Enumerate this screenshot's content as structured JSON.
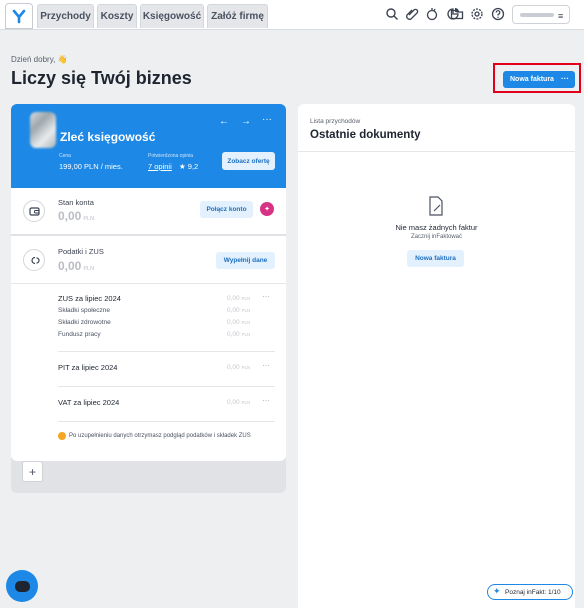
{
  "colors": {
    "accent": "#1d88e5",
    "highlight": "#e3001b",
    "bg": "#eeeff1"
  },
  "topbar": {
    "tabs": [
      {
        "label": "Przychody"
      },
      {
        "label": "Koszty"
      },
      {
        "label": "Księgowość"
      },
      {
        "label": "Załóż firmę"
      }
    ],
    "icons": [
      "search-icon",
      "attachment-icon",
      "settlements-icon",
      "chart-icon",
      "folder-icon",
      "settings-icon",
      "help-icon"
    ],
    "user_menu_icon": "≡"
  },
  "header": {
    "greeting": "Dzień dobry, 👋",
    "title": "Liczy się Twój biznes",
    "new_invoice": "Nowa faktura",
    "more": "···"
  },
  "promo": {
    "title": "Zleć księgowość",
    "price_label": "Cena",
    "price_value": "199,00 PLN / mies.",
    "reviews_label": "Potwierdzona opinia",
    "reviews_link": "7 opinii",
    "rating": "★ 9,2",
    "offer_button": "Zobacz ofertę",
    "prev": "←",
    "next": "→",
    "more": "···"
  },
  "account": {
    "label": "Stan konta",
    "amount": "0,00",
    "currency": "PLN",
    "connect_button": "Połącz konto"
  },
  "taxes": {
    "label": "Podatki i ZUS",
    "amount": "0,00",
    "currency": "PLN",
    "fill_button": "Wypełnij dane",
    "zus": {
      "title": "ZUS za lipiec 2024",
      "amount": "0,00",
      "currency": "PLN",
      "rows": [
        {
          "label": "Składki społeczne",
          "amount": "0,00",
          "currency": "PLN"
        },
        {
          "label": "Składki zdrowotne",
          "amount": "0,00",
          "currency": "PLN"
        },
        {
          "label": "Fundusz pracy",
          "amount": "0,00",
          "currency": "PLN"
        }
      ]
    },
    "pit": {
      "title": "PIT za lipiec 2024",
      "amount": "0,00",
      "currency": "PLN"
    },
    "vat": {
      "title": "VAT za lipiec 2024",
      "amount": "0,00",
      "currency": "PLN"
    },
    "note": "Po uzupełnieniu danych otrzymasz podgląd podatków i składek ZUS"
  },
  "add_widget": "+",
  "documents": {
    "label": "Lista przychodów",
    "title": "Ostatnie dokumenty",
    "empty_title": "Nie masz żadnych faktur",
    "empty_sub": "Zacznij inFaktować",
    "empty_button": "Nowa faktura"
  },
  "tour": {
    "label": "Poznaj inFakt: 1/10"
  }
}
